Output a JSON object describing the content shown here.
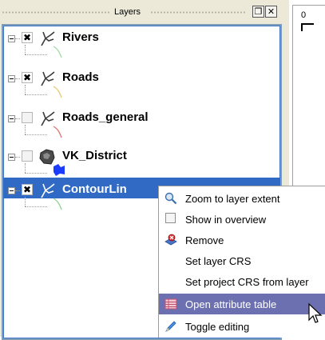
{
  "dock": {
    "title": "Layers",
    "float_glyph": "❐",
    "close_glyph": "✕"
  },
  "layers": [
    {
      "name": "Rivers",
      "checked": true,
      "check_glyph": "✖",
      "icon": "vector-line-icon",
      "symbol": "line",
      "symbol_color": "#9ed99e"
    },
    {
      "name": "Roads",
      "checked": true,
      "check_glyph": "✖",
      "icon": "vector-line-icon",
      "symbol": "line",
      "symbol_color": "#e7c86a"
    },
    {
      "name": "Roads_general",
      "checked": false,
      "check_glyph": "",
      "icon": "vector-line-icon",
      "symbol": "line",
      "symbol_color": "#e07070"
    },
    {
      "name": "VK_District",
      "checked": false,
      "check_glyph": "",
      "icon": "vector-polygon-icon",
      "symbol": "polygon",
      "symbol_color": "#1a3cff"
    },
    {
      "name": "ContourLin",
      "checked": true,
      "check_glyph": "✖",
      "icon": "vector-line-icon",
      "symbol": "line",
      "symbol_color": "#8fd08f",
      "selected": true
    }
  ],
  "map": {
    "tick_label": "0"
  },
  "context_menu": {
    "items": [
      {
        "label": "Zoom to layer extent",
        "icon": "zoom-extent-icon"
      },
      {
        "label": "Show in overview",
        "icon": "checkbox-icon"
      },
      {
        "label": "Remove",
        "icon": "remove-layer-icon"
      },
      {
        "label": "Set layer CRS",
        "icon": ""
      },
      {
        "label": "Set project CRS from layer",
        "icon": ""
      },
      {
        "label": "Open attribute table",
        "icon": "attribute-table-icon",
        "highlighted": true
      },
      {
        "label": "Toggle editing",
        "icon": "pencil-icon"
      }
    ]
  },
  "colors": {
    "selection": "#316ac5",
    "menu_highlight": "#6d70b0",
    "panel_background": "#ece9d8",
    "legend_border": "#7f9db9"
  }
}
